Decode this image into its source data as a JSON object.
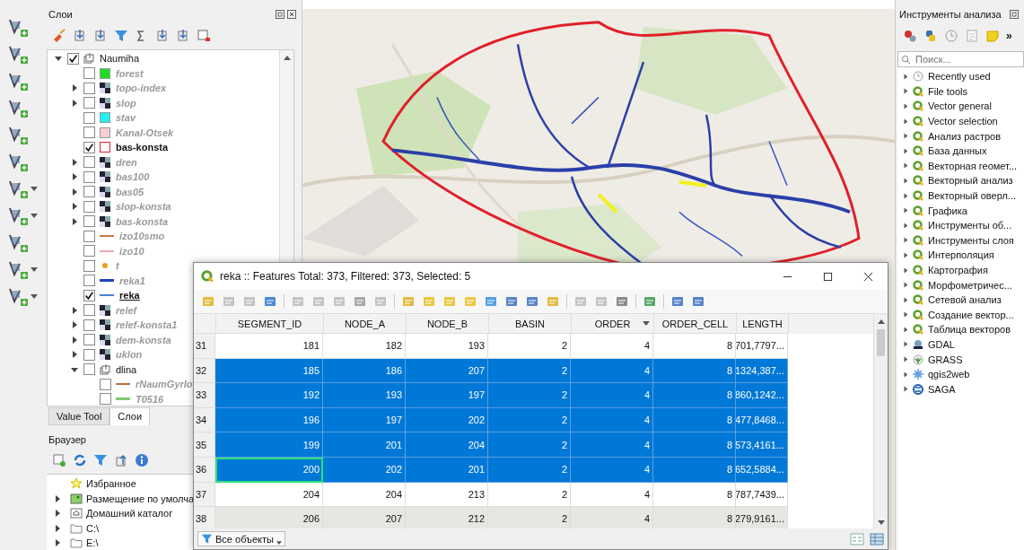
{
  "layers_panel": {
    "title": "Слои",
    "tree": [
      {
        "name": "Naumiha",
        "kind": "group",
        "checked": true,
        "expanded": true,
        "selected": false,
        "children": [
          {
            "name": "forest",
            "kind": "fill",
            "color": "#22dd22",
            "checked": false,
            "selected": false
          },
          {
            "name": "topo-index",
            "kind": "raster",
            "checked": false,
            "expanded": false,
            "selected": false
          },
          {
            "name": "slop",
            "kind": "raster",
            "checked": false,
            "expanded": false,
            "selected": false
          },
          {
            "name": "stav",
            "kind": "fill",
            "color": "#22f0f0",
            "checked": false,
            "selected": false
          },
          {
            "name": "Kanal-Otsek",
            "kind": "fill",
            "color": "#f6cdd0",
            "checked": false,
            "selected": false
          },
          {
            "name": "bas-konsta",
            "kind": "outline",
            "color": "#e8202a",
            "checked": true,
            "selected": false
          },
          {
            "name": "dren",
            "kind": "raster",
            "checked": false,
            "expanded": false,
            "selected": false
          },
          {
            "name": "bas100",
            "kind": "raster",
            "checked": false,
            "expanded": false,
            "selected": false
          },
          {
            "name": "bas05",
            "kind": "raster",
            "checked": false,
            "expanded": false,
            "selected": false
          },
          {
            "name": "slop-konsta",
            "kind": "raster",
            "checked": false,
            "expanded": false,
            "selected": false
          },
          {
            "name": "bas-konsta",
            "kind": "raster",
            "checked": false,
            "expanded": false,
            "selected": false
          },
          {
            "name": "izo10smo",
            "kind": "line",
            "color": "#c8784a",
            "checked": false,
            "selected": false
          },
          {
            "name": "izo10",
            "kind": "line",
            "color": "#f2a8b4",
            "checked": false,
            "selected": false
          },
          {
            "name": "t",
            "kind": "point",
            "color": "#e8a020",
            "checked": false,
            "selected": false
          },
          {
            "name": "reka1",
            "kind": "thickline",
            "color": "#2040c0",
            "checked": false,
            "selected": false
          },
          {
            "name": "reka",
            "kind": "line",
            "color": "#5080d0",
            "checked": true,
            "selected": true
          },
          {
            "name": "relef",
            "kind": "raster",
            "checked": false,
            "expanded": false,
            "selected": false
          },
          {
            "name": "relef-konsta1",
            "kind": "raster",
            "checked": false,
            "expanded": false,
            "selected": false
          },
          {
            "name": "dem-konsta",
            "kind": "raster",
            "checked": false,
            "expanded": false,
            "selected": false
          },
          {
            "name": "uklon",
            "kind": "raster",
            "checked": false,
            "expanded": false,
            "selected": false
          },
          {
            "name": "dlina",
            "kind": "group",
            "checked": false,
            "expanded": true,
            "selected": false,
            "children": [
              {
                "name": "rNaumGyrlo",
                "kind": "line",
                "color": "#b8703a",
                "checked": false,
                "selected": false
              },
              {
                "name": "T0516",
                "kind": "thickline",
                "color": "#80c870",
                "checked": false,
                "selected": false
              }
            ]
          }
        ]
      }
    ]
  },
  "dock_tabs": [
    {
      "label": "Value Tool",
      "selected": false
    },
    {
      "label": "Слои",
      "selected": true
    }
  ],
  "browser": {
    "title": "Браузер",
    "items": [
      {
        "label": "Избранное",
        "kind": "star",
        "expandable": false
      },
      {
        "label": "Размещение по умолча",
        "kind": "map",
        "expandable": true
      },
      {
        "label": "Домашний каталог",
        "kind": "home",
        "expandable": true
      },
      {
        "label": "C:\\",
        "kind": "folder",
        "expandable": true
      },
      {
        "label": "E:\\",
        "kind": "folder",
        "expandable": true
      }
    ]
  },
  "attribute_table": {
    "title": "reka :: Features Total: 373, Filtered: 373, Selected: 5",
    "columns": [
      {
        "label": "SEGMENT_ID",
        "sorted": false
      },
      {
        "label": "NODE_A",
        "sorted": false
      },
      {
        "label": "NODE_B",
        "sorted": false
      },
      {
        "label": "BASIN",
        "sorted": false
      },
      {
        "label": "ORDER",
        "sorted": true
      },
      {
        "label": "ORDER_CELL",
        "sorted": false
      },
      {
        "label": "LENGTH",
        "sorted": false
      }
    ],
    "rows": [
      {
        "number": "31",
        "cells": [
          "181",
          "182",
          "193",
          "2",
          "4",
          "8",
          "701,7797..."
        ],
        "selected": false,
        "current": false
      },
      {
        "number": "32",
        "cells": [
          "185",
          "186",
          "207",
          "2",
          "4",
          "8",
          "1324,387..."
        ],
        "selected": true,
        "current": false
      },
      {
        "number": "33",
        "cells": [
          "192",
          "193",
          "197",
          "2",
          "4",
          "8",
          "860,1242..."
        ],
        "selected": true,
        "current": false
      },
      {
        "number": "34",
        "cells": [
          "196",
          "197",
          "202",
          "2",
          "4",
          "8",
          "477,8468..."
        ],
        "selected": true,
        "current": false
      },
      {
        "number": "35",
        "cells": [
          "199",
          "201",
          "204",
          "2",
          "4",
          "8",
          "573,4161..."
        ],
        "selected": true,
        "current": false
      },
      {
        "number": "36",
        "cells": [
          "200",
          "202",
          "201",
          "2",
          "4",
          "8",
          "652,5884..."
        ],
        "selected": true,
        "current": true
      },
      {
        "number": "37",
        "cells": [
          "204",
          "204",
          "213",
          "2",
          "4",
          "8",
          "787,7439..."
        ],
        "selected": false,
        "current": false
      },
      {
        "number": "38",
        "cells": [
          "206",
          "207",
          "212",
          "2",
          "4",
          "8",
          "279,9161..."
        ],
        "selected": false,
        "current": false
      }
    ],
    "filter_button": "Все объекты"
  },
  "processing_panel": {
    "title": "Инструменты анализа",
    "more": "»",
    "search": {
      "placeholder": "Поиск..."
    },
    "items": [
      {
        "label": "Recently used",
        "kind": "clock"
      },
      {
        "label": "File tools",
        "kind": "qgis"
      },
      {
        "label": "Vector general",
        "kind": "qgis"
      },
      {
        "label": "Vector selection",
        "kind": "qgis"
      },
      {
        "label": "Анализ растров",
        "kind": "qgis"
      },
      {
        "label": "База данных",
        "kind": "qgis"
      },
      {
        "label": "Векторная геомет...",
        "kind": "qgis"
      },
      {
        "label": "Векторный анализ",
        "kind": "qgis"
      },
      {
        "label": "Векторный оверл...",
        "kind": "qgis"
      },
      {
        "label": "Графика",
        "kind": "qgis"
      },
      {
        "label": "Инструменты об...",
        "kind": "qgis"
      },
      {
        "label": "Инструменты слоя",
        "kind": "qgis"
      },
      {
        "label": "Интерполяция",
        "kind": "qgis"
      },
      {
        "label": "Картография",
        "kind": "qgis"
      },
      {
        "label": "Морфометричес...",
        "kind": "qgis"
      },
      {
        "label": "Сетевой анализ",
        "kind": "qgis"
      },
      {
        "label": "Создание вектор...",
        "kind": "qgis"
      },
      {
        "label": "Таблица векторов",
        "kind": "qgis"
      },
      {
        "label": "GDAL",
        "kind": "gdal"
      },
      {
        "label": "GRASS",
        "kind": "grass"
      },
      {
        "label": "qgis2web",
        "kind": "gear"
      },
      {
        "label": "SAGA",
        "kind": "saga"
      }
    ]
  }
}
